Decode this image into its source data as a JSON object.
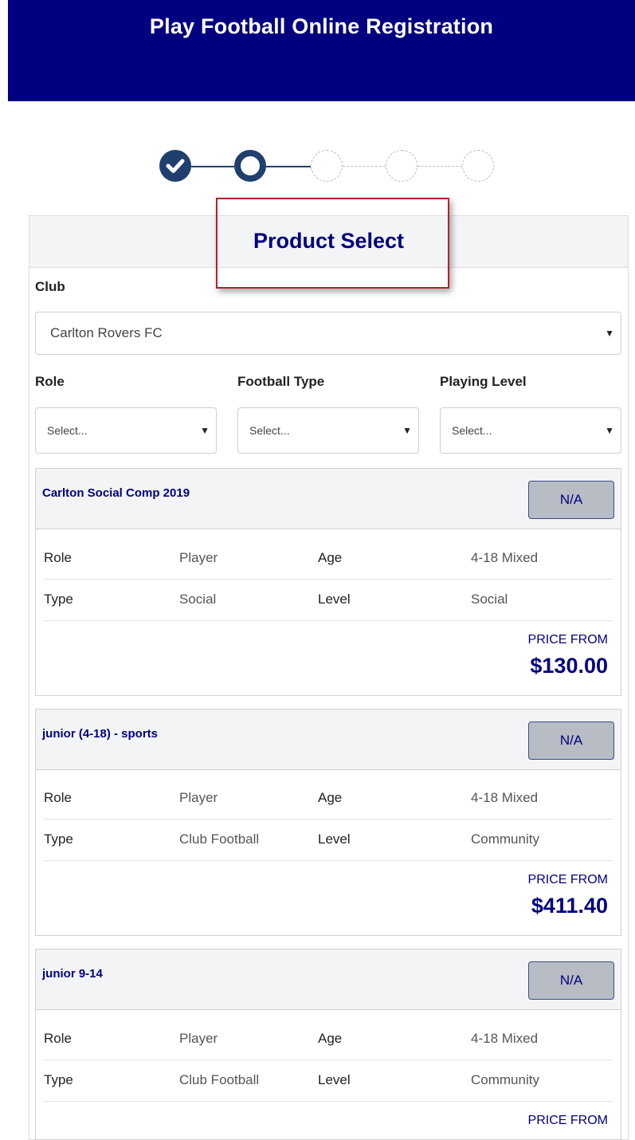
{
  "header": {
    "title": "Play Football Online Registration"
  },
  "stepper": {
    "steps": [
      {
        "state": "done",
        "icon": "check-icon"
      },
      {
        "state": "current",
        "icon": "ring-icon"
      },
      {
        "state": "todo",
        "icon": "empty-circle-icon"
      },
      {
        "state": "todo",
        "icon": "empty-circle-icon"
      },
      {
        "state": "todo",
        "icon": "empty-circle-icon"
      }
    ]
  },
  "panel": {
    "title": "Product Select"
  },
  "filters": {
    "club_label": "Club",
    "club_value": "Carlton Rovers FC",
    "role_label": "Role",
    "role_value": "Select...",
    "type_label": "Football Type",
    "type_value": "Select...",
    "level_label": "Playing Level",
    "level_value": "Select..."
  },
  "products": [
    {
      "name": "Carlton Social Comp 2019",
      "button": "N/A",
      "role_key": "Role",
      "role": "Player",
      "age_key": "Age",
      "age": "4-18 Mixed",
      "type_key": "Type",
      "type": "Social",
      "level_key": "Level",
      "level": "Social",
      "price_from": "PRICE FROM",
      "price": "$130.00"
    },
    {
      "name": "junior (4-18) - sports",
      "button": "N/A",
      "role_key": "Role",
      "role": "Player",
      "age_key": "Age",
      "age": "4-18 Mixed",
      "type_key": "Type",
      "type": "Club Football",
      "level_key": "Level",
      "level": "Community",
      "price_from": "PRICE FROM",
      "price": "$411.40"
    },
    {
      "name": "junior 9-14",
      "button": "N/A",
      "role_key": "Role",
      "role": "Player",
      "age_key": "Age",
      "age": "4-18 Mixed",
      "type_key": "Type",
      "type": "Club Football",
      "level_key": "Level",
      "level": "Community",
      "price_from": "PRICE FROM"
    }
  ],
  "colors": {
    "header_bg": "#000080",
    "accent": "#000080",
    "stepper": "#1f3f6e",
    "highlight_border": "#b3232a"
  }
}
